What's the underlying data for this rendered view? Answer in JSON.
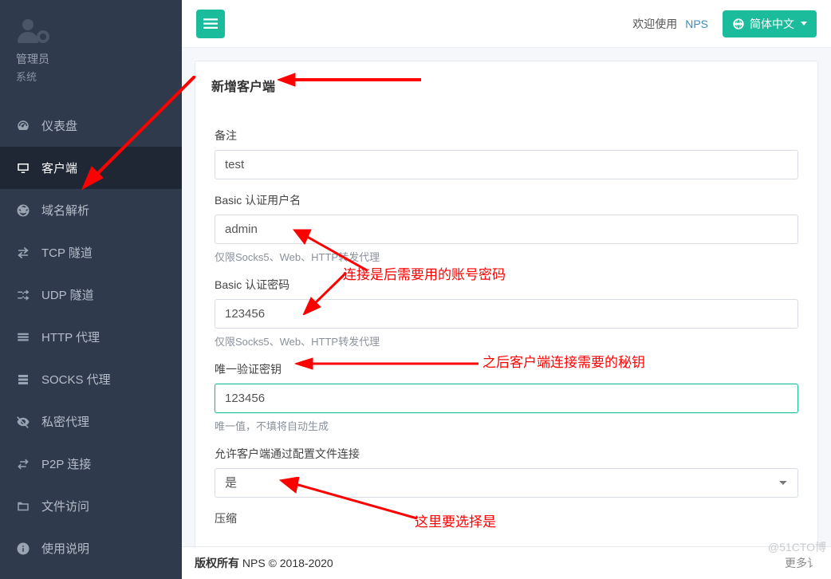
{
  "sidebar": {
    "admin_title": "管理员",
    "admin_sub": "系统",
    "items": [
      {
        "icon": "dashboard",
        "label": "仪表盘"
      },
      {
        "icon": "monitor",
        "label": "客户端"
      },
      {
        "icon": "globe",
        "label": "域名解析"
      },
      {
        "icon": "exchange",
        "label": "TCP 隧道"
      },
      {
        "icon": "shuffle",
        "label": "UDP 隧道"
      },
      {
        "icon": "layers",
        "label": "HTTP 代理"
      },
      {
        "icon": "stack",
        "label": "SOCKS 代理"
      },
      {
        "icon": "eyeoff",
        "label": "私密代理"
      },
      {
        "icon": "swap",
        "label": "P2P 连接"
      },
      {
        "icon": "folder",
        "label": "文件访问"
      },
      {
        "icon": "info",
        "label": "使用说明"
      }
    ]
  },
  "topbar": {
    "welcome": "欢迎使用",
    "app": "NPS",
    "lang": "简体中文"
  },
  "card": {
    "title": "新增客户端",
    "fields": {
      "remark_label": "备注",
      "remark_value": "test",
      "basic_user_label": "Basic 认证用户名",
      "basic_user_value": "admin",
      "basic_help": "仅限Socks5、Web、HTTP转发代理",
      "basic_pass_label": "Basic 认证密码",
      "basic_pass_value": "123456",
      "vkey_label": "唯一验证密钥",
      "vkey_value": "123456",
      "vkey_help": "唯一值，不填将自动生成",
      "allow_conf_label": "允许客户端通过配置文件连接",
      "allow_conf_value": "是",
      "compress_label": "压缩"
    }
  },
  "annotations": {
    "acc_pwd": "连接是后需要用的账号密码",
    "secret": "之后客户端连接需要的秘钥",
    "select_yes": "这里要选择是"
  },
  "footer": {
    "left_bold": "版权所有",
    "left_rest": " NPS © 2018-2020",
    "right": "更多讠"
  },
  "watermark": "@51CTO博"
}
